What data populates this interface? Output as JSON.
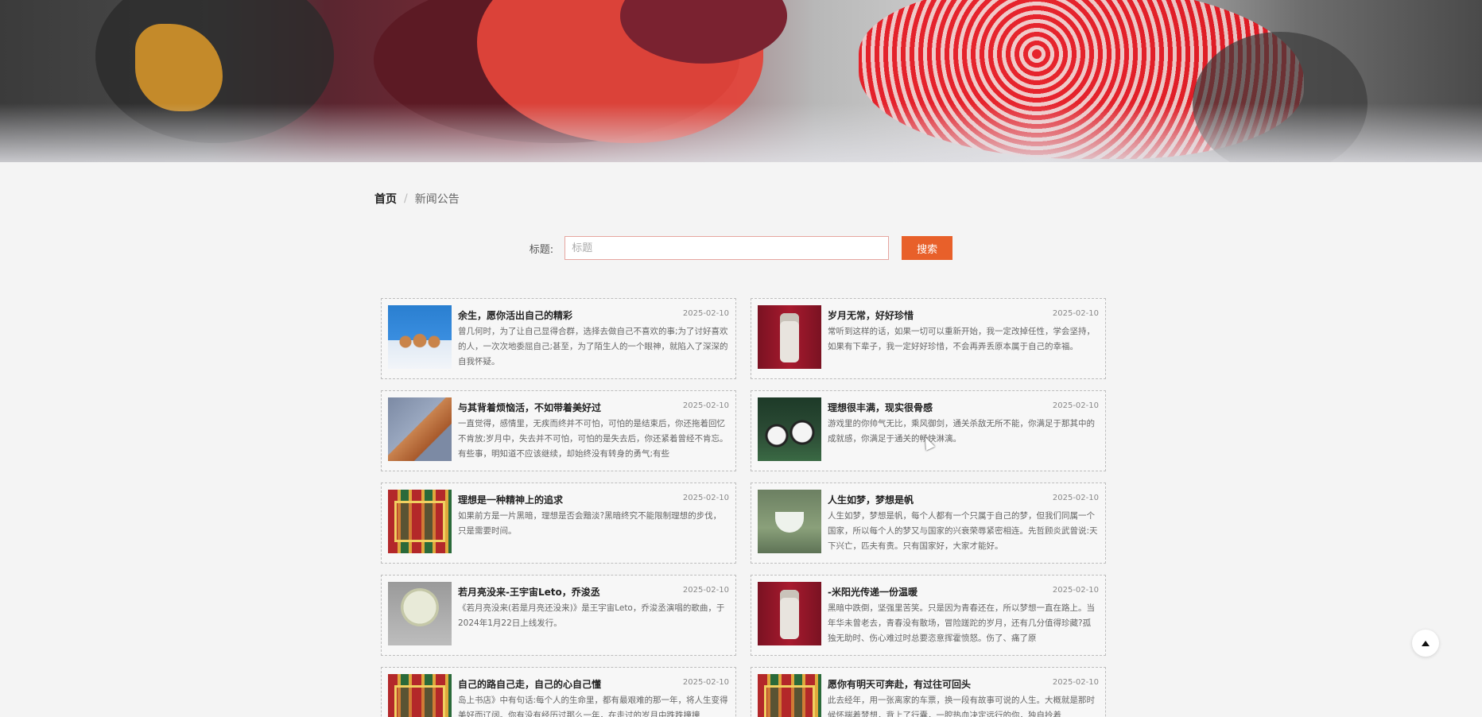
{
  "breadcrumb": {
    "home": "首页",
    "separator": "/",
    "current": "新闻公告"
  },
  "search": {
    "label": "标题:",
    "placeholder": "标题",
    "button": "搜索"
  },
  "news": [
    {
      "title": "余生，愿你活出自己的精彩",
      "date": "2025-02-10",
      "thumb": "th-lab",
      "summary": "曾几何时，为了让自己显得合群，选择去做自己不喜欢的事;为了讨好喜欢的人，一次次地委屈自己;甚至，为了陌生人的一个眼神，就陷入了深深的自我怀疑。"
    },
    {
      "title": "岁月无常，好好珍惜",
      "date": "2025-02-10",
      "thumb": "th-cup",
      "summary": "常听到这样的话，如果一切可以重新开始，我一定改掉任性，学会坚持，如果有下辈子，我一定好好珍惜，不会再弄丢原本属于自己的幸福。"
    },
    {
      "title": "与其背着烦恼活，不如带着美好过",
      "date": "2025-02-10",
      "thumb": "th-cloth",
      "summary": "一直觉得，感情里，无疾而终并不可怕，可怕的是结束后，你还拖着回忆不肯放;岁月中，失去并不可怕，可怕的是失去后，你还紧着曾经不肯忘。有些事，明知道不应该继续，却始终没有转身的勇气;有些"
    },
    {
      "title": "理想很丰满，现实很骨感",
      "date": "2025-02-10",
      "thumb": "th-panda",
      "summary": "游戏里的你帅气无比，乘风御剑，通关杀敌无所不能，你满足于那其中的成就感，你满足于通关的畅快淋漓。"
    },
    {
      "title": "理想是一种精神上的追求",
      "date": "2025-02-10",
      "thumb": "th-opera",
      "summary": "如果前方是一片黑暗，理想是否会黯淡?黑暗终究不能限制理想的步伐，只是需要时间。"
    },
    {
      "title": "人生如梦，梦想是帆",
      "date": "2025-02-10",
      "thumb": "th-teacup",
      "summary": "人生如梦，梦想是帆，每个人都有一个只属于自己的梦，但我们同属一个国家，所以每个人的梦又与国家的兴衰荣辱紧密相连。先哲顾炎武曾说:天下兴亡，匹夫有责。只有国家好，大家才能好。"
    },
    {
      "title": "若月亮没来-王宇宙Leto，乔浚丞",
      "date": "2025-02-10",
      "thumb": "th-fan",
      "summary": "《若月亮没来(若是月亮还没来)》是王宇宙Leto，乔浚丞演唱的歌曲，于2024年1月22日上线发行。"
    },
    {
      "title": "-米阳光传递一份温暖",
      "date": "2025-02-10",
      "thumb": "th-cup",
      "summary": "黑暗中跌倒，坚强里苦笑。只是因为青春还在，所以梦想一直在路上。当年华未曾老去，青春没有散场，冒险蹉跎的岁月，还有几分值得珍藏?孤独无助时、伤心难过时总要恣意挥霍愤怒。伤了、痛了原"
    },
    {
      "title": "自己的路自己走，自己的心自己懂",
      "date": "2025-02-10",
      "thumb": "th-opera",
      "summary": "岛上书店》中有句话:每个人的生命里，都有最艰难的那一年，将人生变得美好而辽阔。你有没有经历过那么一年，在走过的岁月中跌跌撞撞"
    },
    {
      "title": "愿你有明天可奔赴，有过往可回头",
      "date": "2025-02-10",
      "thumb": "th-opera",
      "summary": "此去经年，用一张离家的车票，换一段有故事可说的人生。大概就是那时候怀揣着梦想，背上了行囊，一腔热血决定远行的你，独自拎着"
    }
  ]
}
